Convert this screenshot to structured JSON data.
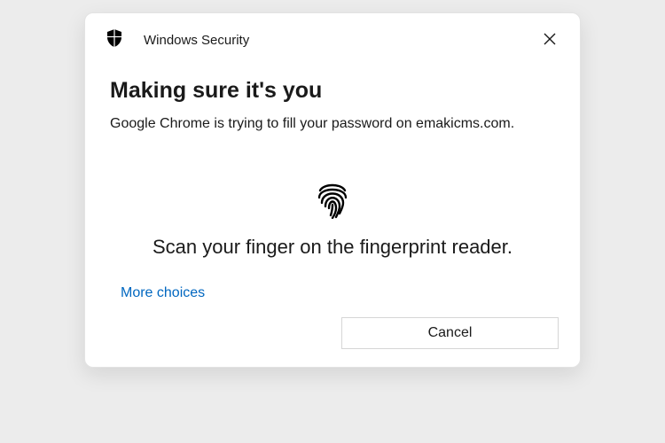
{
  "header": {
    "app_name": "Windows Security"
  },
  "title": "Making sure it's you",
  "message": "Google Chrome is trying to fill your password on emakicms.com.",
  "instruction": "Scan your finger on the fingerprint reader.",
  "more_choices_label": "More choices",
  "cancel_label": "Cancel"
}
